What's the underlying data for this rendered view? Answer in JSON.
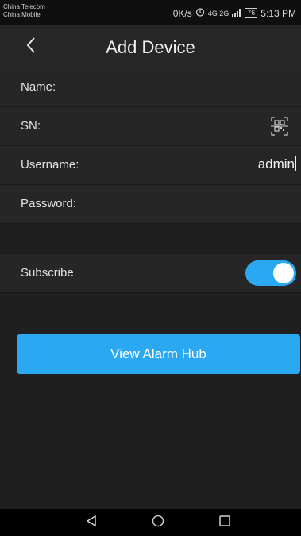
{
  "status": {
    "carrier1": "China Telecom",
    "carrier2": "China Mobile",
    "speed": "0K/s",
    "signal_text": "4G 2G",
    "battery": "76",
    "time": "5:13 PM"
  },
  "header": {
    "title": "Add Device"
  },
  "form": {
    "name_label": "Name:",
    "sn_label": "SN:",
    "username_label": "Username:",
    "username_value": "admin",
    "password_label": "Password:",
    "subscribe_label": "Subscribe",
    "subscribe_on": true
  },
  "actions": {
    "view_alarm_hub": "View Alarm Hub"
  },
  "icons": {
    "back": "chevron-left-icon",
    "scan": "qr-scan-icon",
    "nav_back": "triangle-back-icon",
    "nav_home": "circle-home-icon",
    "nav_recents": "square-recents-icon"
  },
  "colors": {
    "accent": "#2aa8f2",
    "background": "#1f1f1f",
    "row": "#262626"
  }
}
